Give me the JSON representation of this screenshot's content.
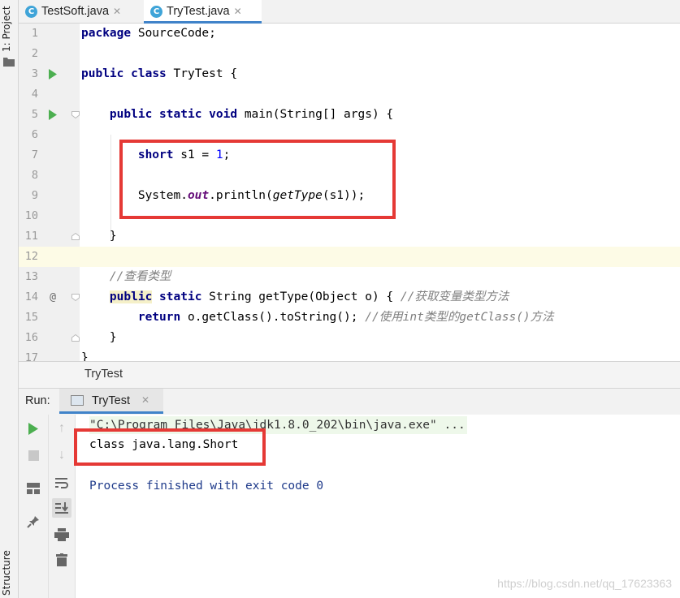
{
  "left_strip": {
    "project_tab": "1: Project",
    "structure_tab": "Structure"
  },
  "tabs": [
    {
      "label": "TestSoft.java",
      "icon": "java-class-icon",
      "active": false
    },
    {
      "label": "TryTest.java",
      "icon": "java-class-icon",
      "active": true
    }
  ],
  "editor": {
    "line_numbers": [
      "1",
      "2",
      "3",
      "4",
      "5",
      "6",
      "7",
      "8",
      "9",
      "10",
      "11",
      "12",
      "13",
      "14",
      "15",
      "16",
      "17"
    ],
    "line_1": {
      "kw": "package",
      "rest": " SourceCode;"
    },
    "line_3": {
      "kw1": "public",
      "kw2": "class",
      "rest": " TryTest {"
    },
    "line_5": {
      "kw1": "public",
      "kw2": "static",
      "kw3": "void",
      "rest": " main(String[] args) {"
    },
    "line_7": {
      "kw": "short",
      "mid": " s1 = ",
      "num": "1",
      "end": ";"
    },
    "line_9": {
      "a": "System.",
      "field": "out",
      "b": ".println(",
      "method": "getType",
      "c": "(s1));"
    },
    "line_11": {
      "text": "}"
    },
    "line_13": {
      "comment": "//查看类型"
    },
    "line_14": {
      "kw1": "public",
      "kw2": "static",
      "rest": " String getType(Object o) { ",
      "comment": "//获取变量类型方法"
    },
    "line_15": {
      "kw": "return",
      "rest": " o.getClass().toString(); ",
      "comment": "//使用int类型的getClass()方法"
    },
    "line_16": {
      "text": "}"
    },
    "line_17": {
      "text": "}"
    }
  },
  "breadcrumb": {
    "label": "TryTest"
  },
  "run_panel": {
    "label": "Run:",
    "tab_label": "TryTest",
    "console": {
      "command": "\"C:\\Program Files\\Java\\jdk1.8.0_202\\bin\\java.exe\" ...",
      "output": "class java.lang.Short",
      "process": "Process finished with exit code 0"
    }
  },
  "watermark": "https://blog.csdn.net/qq_17623363",
  "colors": {
    "keyword": "#000080",
    "number": "#0000ff",
    "comment": "#808080",
    "highlight_box": "#e53935",
    "accent": "#4083c9"
  }
}
